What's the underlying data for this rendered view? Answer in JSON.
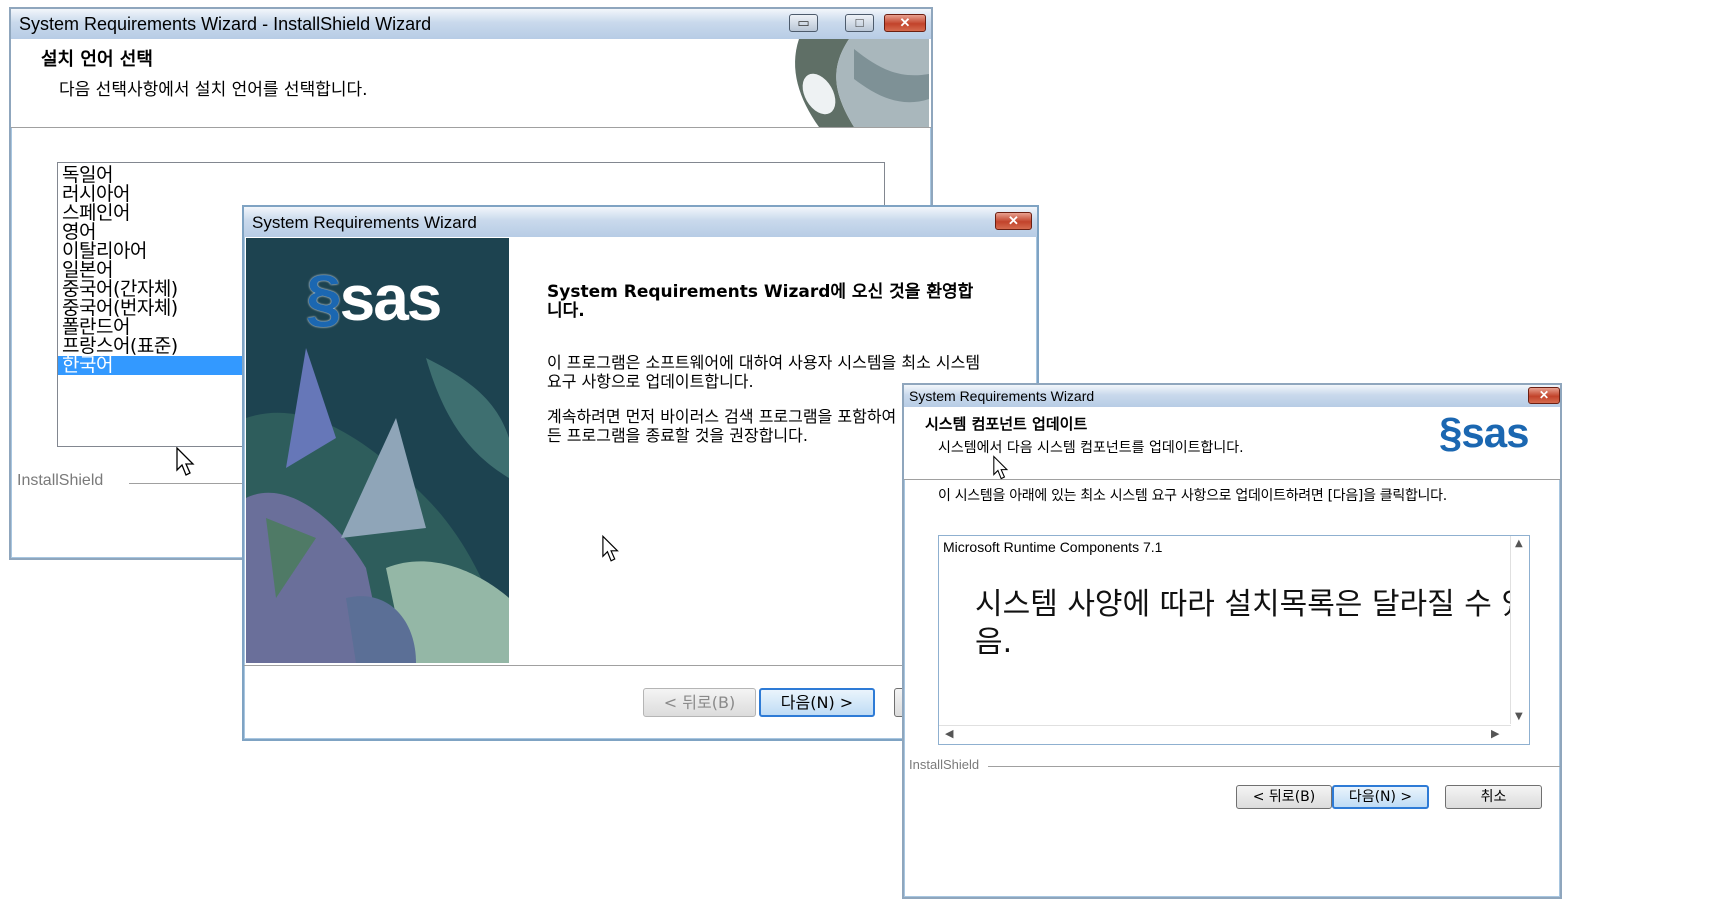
{
  "lang_dialog": {
    "title": "System Requirements Wizard - InstallShield Wizard",
    "heading": "설치 언어 선택",
    "subheading": "다음 선택사항에서 설치 언어를 선택합니다.",
    "languages": [
      "독일어",
      "러시아어",
      "스페인어",
      "영어",
      "이탈리아어",
      "일본어",
      "중국어(간자체)",
      "중국어(번자체)",
      "폴란드어",
      "프랑스어(표준)",
      "한국어"
    ],
    "selected_index": 10,
    "footer_brand": "InstallShield"
  },
  "welcome_dialog": {
    "title": "System Requirements Wizard",
    "logo": "sas",
    "heading": "System Requirements Wizard에 오신 것을 환영합니다.",
    "para1": "이 프로그램은 소프트웨어에 대하여 사용자 시스템을 최소 시스템 요구 사항으로 업데이트합니다.",
    "para2": "계속하려면 먼저 바이러스 검색 프로그램을 포함하여 실행 중인 모든 프로그램을 종료할 것을 권장합니다.",
    "back_button": "< 뒤로(B)",
    "next_button": "다음(N) >"
  },
  "update_dialog": {
    "title": "System Requirements Wizard",
    "heading": "시스템 컴포넌트 업데이트",
    "subheading": "시스템에서 다음 시스템 컴포넌트를 업데이트합니다.",
    "logo": "sas",
    "instruction": "이 시스템을 아래에 있는 최소 시스템 요구 사항으로 업데이트하려면 [다음]을 클릭합니다.",
    "components": [
      "Microsoft Runtime Components 7.1"
    ],
    "overlay_note": "시스템 사양에 따라 설치목록은 달라질 수 있음.",
    "footer_brand": "InstallShield",
    "back_button": "< 뒤로(B)",
    "next_button": "다음(N) >",
    "cancel_button": "취소"
  },
  "colors": {
    "selection": "#3399ff",
    "sas_blue": "#1b67b1",
    "default_button_border": "#2e7bd6"
  }
}
